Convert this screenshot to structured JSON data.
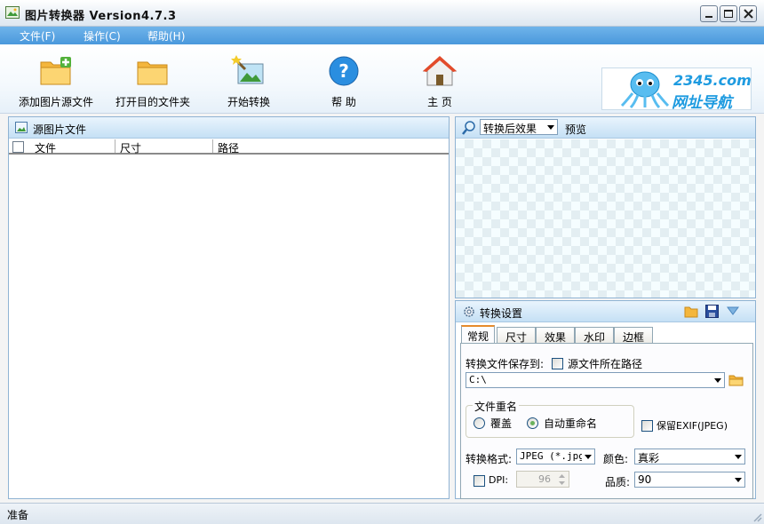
{
  "window": {
    "title": "图片转换器 Version4.7.3",
    "controls": {
      "minimize": "minimize",
      "maximize": "maximize",
      "close": "close"
    }
  },
  "menu": [
    {
      "label": "文件(F)"
    },
    {
      "label": "操作(C)"
    },
    {
      "label": "帮助(H)"
    }
  ],
  "toolbar": {
    "add_source": "添加图片源文件",
    "open_dest": "打开目的文件夹",
    "start_convert": "开始转换",
    "help": "帮 助",
    "home": "主 页"
  },
  "ad": {
    "brand_line1": "2345.com",
    "brand_line2": "网址导航"
  },
  "left_panel": {
    "title": "源图片文件",
    "columns": [
      "文件",
      "尺寸",
      "路径"
    ]
  },
  "preview": {
    "mode": "转换后效果",
    "label": "预览"
  },
  "settings": {
    "title": "转换设置",
    "tabs": [
      "常规",
      "尺寸",
      "效果",
      "水印",
      "边框"
    ],
    "active_tab": "常规",
    "save_to_label": "转换文件保存到:",
    "source_path_label": "源文件所在路径",
    "source_path_checked": false,
    "save_path": "C:\\",
    "rename_group": "文件重名",
    "overwrite": "覆盖",
    "auto_rename": "自动重命名",
    "rename_selected": "auto_rename",
    "keep_exif": "保留EXIF(JPEG)",
    "keep_exif_checked": false,
    "format_label": "转换格式:",
    "format_value": "JPEG (*.jpg",
    "color_label": "颜色:",
    "color_value": "真彩",
    "dpi_label": "DPI:",
    "dpi_value": "96",
    "dpi_checked": false,
    "quality_label": "品质:",
    "quality_value": "90"
  },
  "status": {
    "text": "准备"
  },
  "colors": {
    "menubar": "#4a98dc",
    "accent_tab": "#e68b2c",
    "panel_border": "#8fb3d3"
  }
}
